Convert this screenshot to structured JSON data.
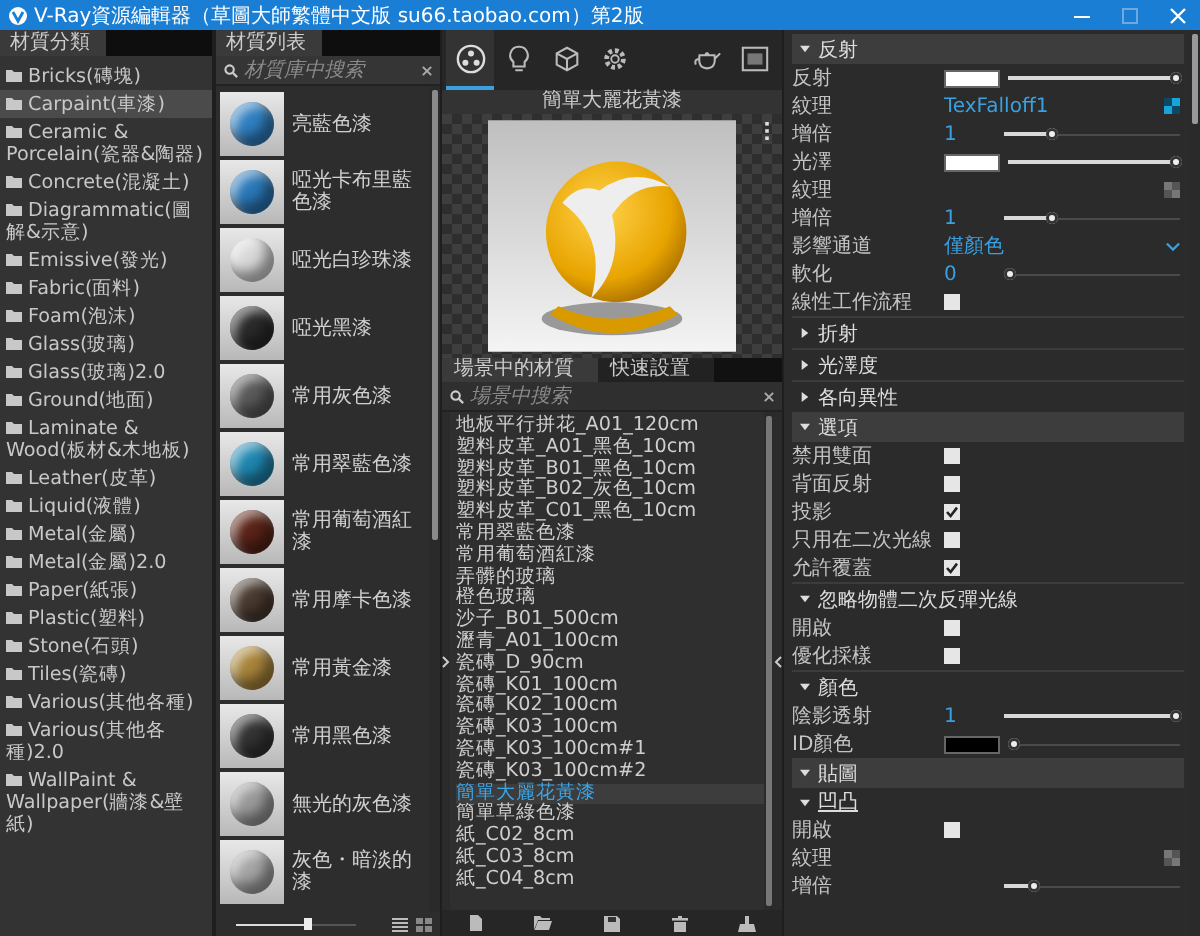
{
  "window": {
    "title": "V-Ray資源編輯器（草圖大師繁體中文版 su66.taobao.com）第2版"
  },
  "categories": {
    "tab": "材質分類",
    "items": [
      {
        "label": "Bricks(磚塊)",
        "selected": false
      },
      {
        "label": "Carpaint(車漆)",
        "selected": true
      },
      {
        "label": "Ceramic & Porcelain(瓷器&陶器)",
        "selected": false
      },
      {
        "label": "Concrete(混凝土)",
        "selected": false
      },
      {
        "label": "Diagrammatic(圖解&示意)",
        "selected": false
      },
      {
        "label": "Emissive(發光)",
        "selected": false
      },
      {
        "label": "Fabric(面料)",
        "selected": false
      },
      {
        "label": "Foam(泡沫)",
        "selected": false
      },
      {
        "label": "Glass(玻璃)",
        "selected": false
      },
      {
        "label": "Glass(玻璃)2.0",
        "selected": false
      },
      {
        "label": "Ground(地面)",
        "selected": false
      },
      {
        "label": "Laminate & Wood(板材&木地板)",
        "selected": false
      },
      {
        "label": "Leather(皮革)",
        "selected": false
      },
      {
        "label": "Liquid(液體)",
        "selected": false
      },
      {
        "label": "Metal(金屬)",
        "selected": false
      },
      {
        "label": "Metal(金屬)2.0",
        "selected": false
      },
      {
        "label": "Paper(紙張)",
        "selected": false
      },
      {
        "label": "Plastic(塑料)",
        "selected": false
      },
      {
        "label": "Stone(石頭)",
        "selected": false
      },
      {
        "label": "Tiles(瓷磚)",
        "selected": false
      },
      {
        "label": "Various(其他各種)",
        "selected": false
      },
      {
        "label": "Various(其他各種)2.0",
        "selected": false
      },
      {
        "label": "WallPaint & Wallpaper(牆漆&壁紙)",
        "selected": false
      }
    ]
  },
  "materials": {
    "tab": "材質列表",
    "search": {
      "placeholder": "材質庫中搜索"
    },
    "items": [
      {
        "name": "亮藍色漆",
        "color": "#2f7fc0"
      },
      {
        "name": "啞光卡布里藍色漆",
        "color": "#2a78b8"
      },
      {
        "name": "啞光白珍珠漆",
        "color": "#d8d8d8"
      },
      {
        "name": "啞光黑漆",
        "color": "#2a2a2a"
      },
      {
        "name": "常用灰色漆",
        "color": "#5a5a5a"
      },
      {
        "name": "常用翠藍色漆",
        "color": "#1f86b0"
      },
      {
        "name": "常用葡萄酒紅漆",
        "color": "#5a2418"
      },
      {
        "name": "常用摩卡色漆",
        "color": "#4a3a30"
      },
      {
        "name": "常用黃金漆",
        "color": "#a8843a"
      },
      {
        "name": "常用黑色漆",
        "color": "#333333"
      },
      {
        "name": "無光的灰色漆",
        "color": "#9a9a9a"
      },
      {
        "name": "灰色・暗淡的漆",
        "color": "#a5a5a5"
      }
    ],
    "size_slider": {
      "level": 0.6
    }
  },
  "toolbar": {
    "tabs": [
      {
        "kind": "materials",
        "selected": true
      },
      {
        "kind": "lights",
        "selected": false
      },
      {
        "kind": "geometry",
        "selected": false
      },
      {
        "kind": "settings",
        "selected": false
      },
      {
        "kind": "render",
        "selected": false
      },
      {
        "kind": "frame-buffer",
        "selected": false
      }
    ]
  },
  "preview": {
    "title": "簡單大麗花黃漆"
  },
  "scene": {
    "tabs": [
      {
        "label": "場景中的材質",
        "selected": true
      },
      {
        "label": "快速設置",
        "selected": false
      }
    ],
    "search": {
      "placeholder": "場景中搜索"
    },
    "items": [
      {
        "name": "地板平行拼花_A01_120cm",
        "selected": false
      },
      {
        "name": "塑料皮革_A01_黑色_10cm",
        "selected": false
      },
      {
        "name": "塑料皮革_B01_黑色_10cm",
        "selected": false
      },
      {
        "name": "塑料皮革_B02_灰色_10cm",
        "selected": false
      },
      {
        "name": "塑料皮革_C01_黑色_10cm",
        "selected": false
      },
      {
        "name": "常用翠藍色漆",
        "selected": false
      },
      {
        "name": "常用葡萄酒紅漆",
        "selected": false
      },
      {
        "name": "弄髒的玻璃",
        "selected": false
      },
      {
        "name": "橙色玻璃",
        "selected": false
      },
      {
        "name": "沙子_B01_500cm",
        "selected": false
      },
      {
        "name": "瀝青_A01_100cm",
        "selected": false
      },
      {
        "name": "瓷磚_D_90cm",
        "selected": false
      },
      {
        "name": "瓷磚_K01_100cm",
        "selected": false
      },
      {
        "name": "瓷磚_K02_100cm",
        "selected": false
      },
      {
        "name": "瓷磚_K03_100cm",
        "selected": false
      },
      {
        "name": "瓷磚_K03_100cm#1",
        "selected": false
      },
      {
        "name": "瓷磚_K03_100cm#2",
        "selected": false
      },
      {
        "name": "簡單大麗花黃漆",
        "selected": true
      },
      {
        "name": "簡單草綠色漆",
        "selected": false
      },
      {
        "name": "紙_C02_8cm",
        "selected": false
      },
      {
        "name": "紙_C03_8cm",
        "selected": false
      },
      {
        "name": "紙_C04_8cm",
        "selected": false
      }
    ]
  },
  "properties": {
    "rows": [
      {
        "kind": "group",
        "title": "反射",
        "expanded": true
      },
      {
        "kind": "color",
        "label": "反射",
        "color": "#ffffff",
        "level": 1
      },
      {
        "kind": "texture",
        "label": "紋理",
        "value": "TexFalloff1",
        "assigned": true
      },
      {
        "kind": "slider",
        "label": "增倍",
        "value": "1",
        "level": 0.25
      },
      {
        "kind": "color",
        "label": "光澤",
        "color": "#ffffff",
        "level": 1
      },
      {
        "kind": "texture",
        "label": "紋理",
        "assigned": false
      },
      {
        "kind": "slider",
        "label": "增倍",
        "value": "1",
        "level": 0.25
      },
      {
        "kind": "dropdown",
        "label": "影響通道",
        "value": "僅顏色"
      },
      {
        "kind": "slider",
        "label": "軟化",
        "value": "0",
        "level": 0
      },
      {
        "kind": "checkbox",
        "label": "線性工作流程",
        "checked": false
      },
      {
        "kind": "section",
        "title": "折射",
        "expanded": false
      },
      {
        "kind": "section",
        "title": "光澤度",
        "expanded": false
      },
      {
        "kind": "section",
        "title": "各向異性",
        "expanded": false
      },
      {
        "kind": "group",
        "title": "選項",
        "expanded": true
      },
      {
        "kind": "checkbox",
        "label": "禁用雙面",
        "checked": false
      },
      {
        "kind": "checkbox",
        "label": "背面反射",
        "checked": false
      },
      {
        "kind": "checkbox",
        "label": "投影",
        "checked": true
      },
      {
        "kind": "checkbox",
        "label": "只用在二次光線",
        "checked": false
      },
      {
        "kind": "checkbox",
        "label": "允許覆蓋",
        "checked": true
      },
      {
        "kind": "section",
        "title": "忽略物體二次反彈光線",
        "expanded": true
      },
      {
        "kind": "checkbox",
        "label": "開啟",
        "checked": false
      },
      {
        "kind": "checkbox",
        "label": "優化採樣",
        "checked": false
      },
      {
        "kind": "section",
        "title": "顏色",
        "expanded": true
      },
      {
        "kind": "slider",
        "label": "陰影透射",
        "value": "1",
        "level": 1
      },
      {
        "kind": "color",
        "label": "ID顏色",
        "color": "#000000",
        "level": 0
      },
      {
        "kind": "group",
        "title": "貼圖",
        "expanded": true
      },
      {
        "kind": "subsection",
        "title": "凹凸",
        "expanded": true
      },
      {
        "kind": "checkbox",
        "label": "開啟",
        "checked": false
      },
      {
        "kind": "texture",
        "label": "紋理",
        "assigned": false
      },
      {
        "kind": "slider",
        "label": "增倍",
        "level": 0.15
      }
    ]
  }
}
